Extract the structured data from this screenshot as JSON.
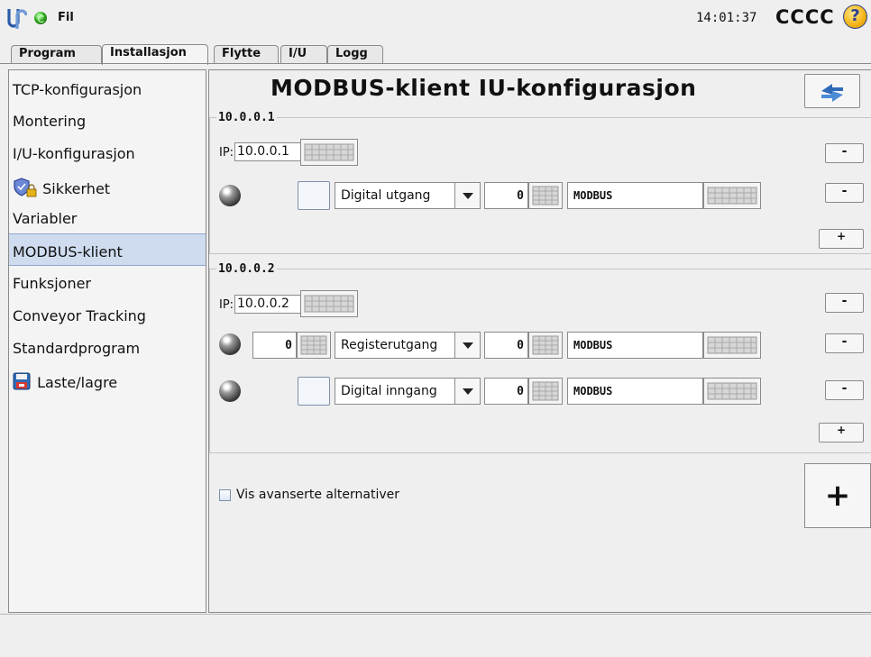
{
  "topbar": {
    "menu_label": "Fil",
    "time": "14:01:37",
    "robot_name": "CCCC",
    "help_label": "?",
    "status_color": "#2fa51f"
  },
  "tabs": [
    {
      "label": "Program",
      "active": false
    },
    {
      "label": "Installasjon",
      "active": true
    },
    {
      "label": "Flytte",
      "active": false
    },
    {
      "label": "I/U",
      "active": false
    },
    {
      "label": "Logg",
      "active": false
    }
  ],
  "sidebar": {
    "items": [
      {
        "label": "TCP-konfigurasjon",
        "icon": null
      },
      {
        "label": "Montering",
        "icon": null
      },
      {
        "label": "I/U-konfigurasjon",
        "icon": null
      },
      {
        "label": "Sikkerhet",
        "icon": "shield-lock-icon"
      },
      {
        "label": "Variabler",
        "icon": null
      },
      {
        "label": "MODBUS-klient",
        "icon": null,
        "selected": true
      },
      {
        "label": "Funksjoner",
        "icon": null
      },
      {
        "label": "Conveyor Tracking",
        "icon": null
      },
      {
        "label": "Standardprogram",
        "icon": null
      },
      {
        "label": "Laste/lagre",
        "icon": "floppy-disk-icon"
      }
    ]
  },
  "main": {
    "title": "MODBUS-klient IU-konfigurasjon",
    "ip_prefix": "IP:",
    "remove_label": "-",
    "add_label": "+",
    "units": [
      {
        "name": "10.0.0.1",
        "ip": "10.0.0.1",
        "signals": [
          {
            "value_kind": "checkbox",
            "value": "",
            "type": "Digital utgang",
            "address": "0",
            "name": "MODBUS"
          }
        ]
      },
      {
        "name": "10.0.0.2",
        "ip": "10.0.0.2",
        "signals": [
          {
            "value_kind": "number",
            "value": "0",
            "type": "Registerutgang",
            "address": "0",
            "name": "MODBUS"
          },
          {
            "value_kind": "checkbox",
            "value": "",
            "type": "Digital inngang",
            "address": "0",
            "name": "MODBUS"
          }
        ]
      }
    ],
    "advanced_checkbox_label": "Vis avanserte alternativer",
    "advanced_checked": false,
    "add_unit_label": "+"
  }
}
